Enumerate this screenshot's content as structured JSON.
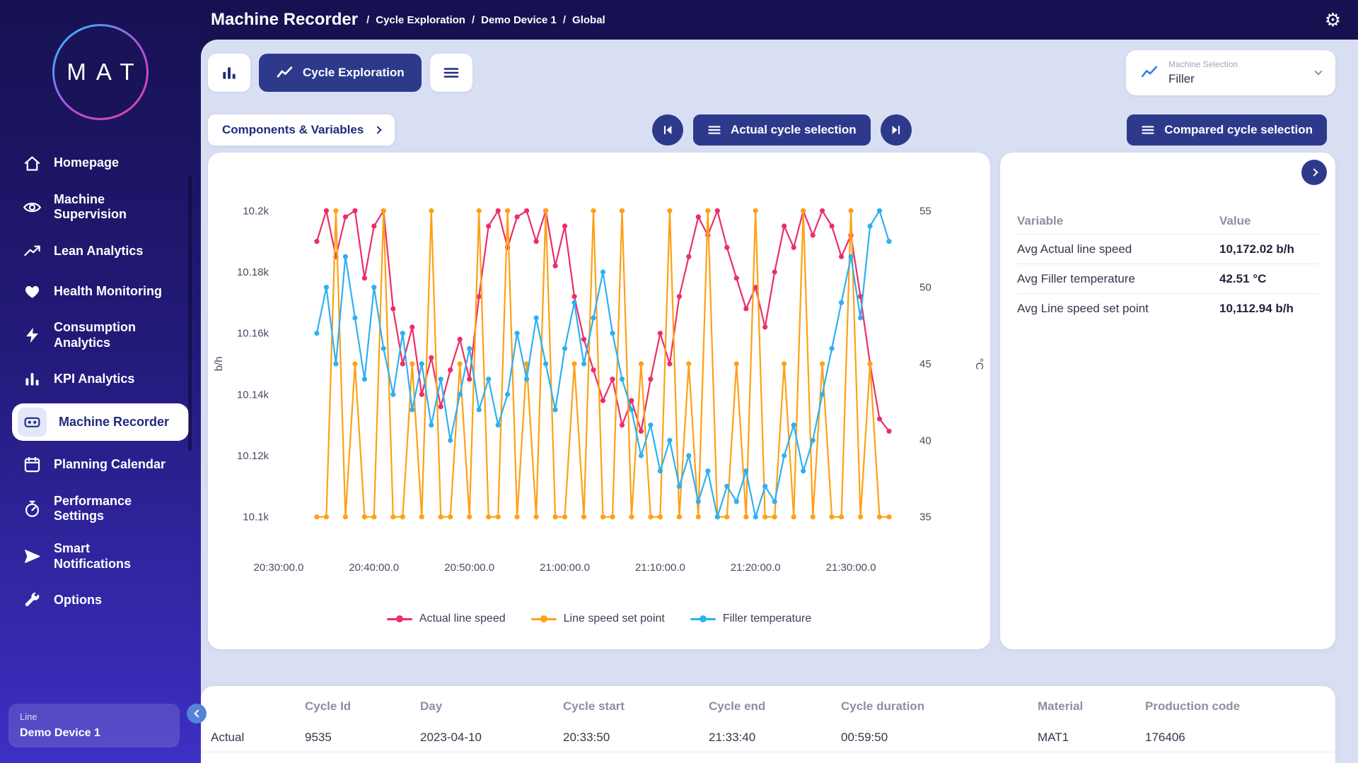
{
  "icons": {
    "gear": "⚙"
  },
  "colors": {
    "primary_navy": "#2d3a8c",
    "sidebar_top": "#171152",
    "sidebar_bottom": "#3d30c4",
    "main_background": "#d9dff3",
    "series_pink": "#ec2e68",
    "series_orange": "#ffa016",
    "series_blue": "#2fb0f2"
  },
  "header": {
    "title": "Machine Recorder",
    "breadcrumb_separator": "/",
    "breadcrumbs": [
      "Cycle Exploration",
      "Demo Device 1",
      "Global"
    ]
  },
  "sidebar": {
    "logo": "MAT",
    "items": [
      {
        "label": "Homepage",
        "icon": "home-icon",
        "active": false
      },
      {
        "label": "Machine Supervision",
        "icon": "eye-icon",
        "active": false
      },
      {
        "label": "Lean Analytics",
        "icon": "trend-icon",
        "active": false
      },
      {
        "label": "Health Monitoring",
        "icon": "heart-icon",
        "active": false
      },
      {
        "label": "Consumption Analytics",
        "icon": "bolt-icon",
        "active": false
      },
      {
        "label": "KPI Analytics",
        "icon": "bar-chart-icon",
        "active": false
      },
      {
        "label": "Machine Recorder",
        "icon": "recorder-icon",
        "active": true
      },
      {
        "label": "Planning Calendar",
        "icon": "calendar-icon",
        "active": false
      },
      {
        "label": "Performance Settings",
        "icon": "gauge-icon",
        "active": false
      },
      {
        "label": "Smart Notifications",
        "icon": "send-icon",
        "active": false
      },
      {
        "label": "Options",
        "icon": "wrench-icon",
        "active": false
      }
    ],
    "line_card": {
      "label": "Line",
      "value": "Demo Device 1"
    }
  },
  "toolbar": {
    "cycle_exploration_label": "Cycle Exploration",
    "machine_selection": {
      "label": "Machine Selection",
      "value": "Filler"
    },
    "components_variables_label": "Components & Variables",
    "actual_cycle_selection_label": "Actual cycle selection",
    "compared_cycle_selection_label": "Compared cycle selection"
  },
  "stats_panel": {
    "columns": [
      "Variable",
      "Value"
    ],
    "rows": [
      {
        "variable": "Avg Actual line speed",
        "value": "10,172.02 b/h"
      },
      {
        "variable": "Avg Filler temperature",
        "value": "42.51 °C"
      },
      {
        "variable": "Avg Line speed set point",
        "value": "10,112.94 b/h"
      }
    ]
  },
  "cycle_table": {
    "columns": [
      "",
      "Cycle Id",
      "Day",
      "Cycle start",
      "Cycle end",
      "Cycle duration",
      "Material",
      "Production code"
    ],
    "rows": [
      {
        "name": "Actual",
        "cycle_id": "9535",
        "day": "2023-04-10",
        "cycle_start": "20:33:50",
        "cycle_end": "21:33:40",
        "cycle_duration": "00:59:50",
        "material": "MAT1",
        "production_code": "176406"
      }
    ]
  },
  "chart_data": {
    "type": "line",
    "title": "",
    "grid": false,
    "legend_position": "bottom",
    "x_axis": {
      "start_minute": 4,
      "step_minutes": 1,
      "domain_minutes": [
        0,
        66
      ],
      "base_time": "20:30:00",
      "ticks": [
        {
          "minute": 0,
          "label": "20:30:00.0"
        },
        {
          "minute": 10,
          "label": "20:40:00.0"
        },
        {
          "minute": 20,
          "label": "20:50:00.0"
        },
        {
          "minute": 30,
          "label": "21:00:00.0"
        },
        {
          "minute": 40,
          "label": "21:10:00.0"
        },
        {
          "minute": 50,
          "label": "21:20:00.0"
        },
        {
          "minute": 60,
          "label": "21:30:00.0"
        }
      ]
    },
    "left_axis": {
      "label": "b/h",
      "range": [
        10093,
        10207
      ],
      "ticks": [
        {
          "value": 10100,
          "label": "10.1k"
        },
        {
          "value": 10120,
          "label": "10.12k"
        },
        {
          "value": 10140,
          "label": "10.14k"
        },
        {
          "value": 10160,
          "label": "10.16k"
        },
        {
          "value": 10180,
          "label": "10.18k"
        },
        {
          "value": 10200,
          "label": "10.2k"
        }
      ]
    },
    "right_axis": {
      "label": "°C",
      "range": [
        33.6,
        56.4
      ],
      "ticks": [
        {
          "value": 35,
          "label": "35"
        },
        {
          "value": 40,
          "label": "40"
        },
        {
          "value": 45,
          "label": "45"
        },
        {
          "value": 50,
          "label": "50"
        },
        {
          "value": 55,
          "label": "55"
        }
      ]
    },
    "series": [
      {
        "name": "Actual line speed",
        "color": "#ec2e68",
        "axis": "left",
        "values": [
          10190,
          10200,
          10185,
          10198,
          10200,
          10178,
          10195,
          10200,
          10168,
          10150,
          10162,
          10140,
          10152,
          10136,
          10148,
          10158,
          10145,
          10172,
          10195,
          10200,
          10188,
          10198,
          10200,
          10190,
          10200,
          10182,
          10195,
          10172,
          10158,
          10148,
          10138,
          10145,
          10130,
          10138,
          10128,
          10145,
          10160,
          10150,
          10172,
          10185,
          10198,
          10192,
          10200,
          10188,
          10178,
          10168,
          10175,
          10162,
          10180,
          10195,
          10188,
          10200,
          10192,
          10200,
          10195,
          10185,
          10192,
          10172,
          10150,
          10132,
          10128
        ]
      },
      {
        "name": "Line speed set point",
        "color": "#ffa016",
        "axis": "left",
        "values": [
          10100,
          10100,
          10200,
          10100,
          10150,
          10100,
          10100,
          10200,
          10100,
          10100,
          10150,
          10100,
          10200,
          10100,
          10100,
          10150,
          10100,
          10200,
          10100,
          10100,
          10200,
          10100,
          10150,
          10100,
          10200,
          10100,
          10100,
          10150,
          10100,
          10200,
          10100,
          10100,
          10200,
          10100,
          10150,
          10100,
          10100,
          10200,
          10100,
          10150,
          10100,
          10200,
          10100,
          10100,
          10150,
          10100,
          10200,
          10100,
          10100,
          10150,
          10100,
          10200,
          10100,
          10150,
          10100,
          10100,
          10200,
          10100,
          10150,
          10100,
          10100
        ]
      },
      {
        "name": "Filler temperature",
        "color": "#2fb0f2",
        "axis": "right",
        "values": [
          47,
          50,
          45,
          52,
          48,
          44,
          50,
          46,
          43,
          47,
          42,
          45,
          41,
          44,
          40,
          43,
          46,
          42,
          44,
          41,
          43,
          47,
          44,
          48,
          45,
          42,
          46,
          49,
          45,
          48,
          51,
          47,
          44,
          42,
          39,
          41,
          38,
          40,
          37,
          39,
          36,
          38,
          35,
          37,
          36,
          38,
          35,
          37,
          36,
          39,
          41,
          38,
          40,
          43,
          46,
          49,
          52,
          48,
          54,
          55,
          53
        ]
      }
    ]
  }
}
